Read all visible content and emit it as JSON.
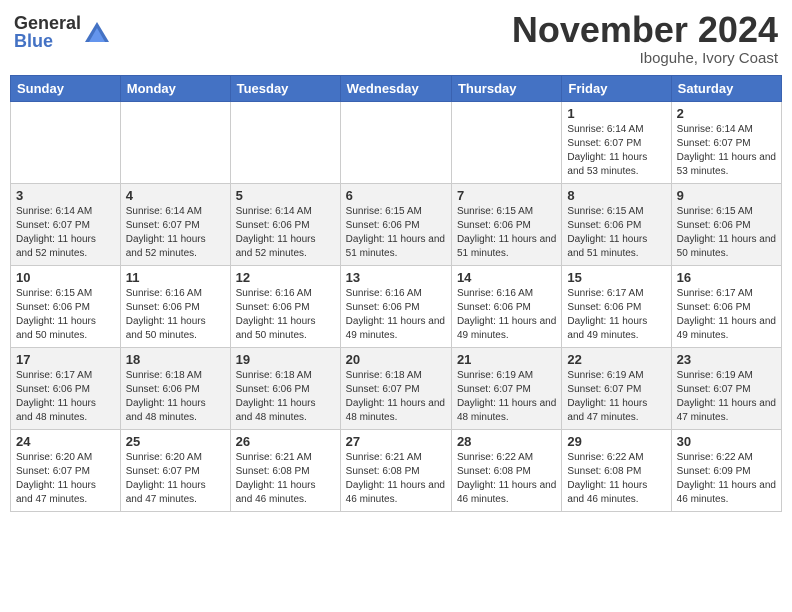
{
  "logo": {
    "general": "General",
    "blue": "Blue"
  },
  "title": "November 2024",
  "location": "Iboguhe, Ivory Coast",
  "weekdays": [
    "Sunday",
    "Monday",
    "Tuesday",
    "Wednesday",
    "Thursday",
    "Friday",
    "Saturday"
  ],
  "weeks": [
    [
      {
        "day": "",
        "info": ""
      },
      {
        "day": "",
        "info": ""
      },
      {
        "day": "",
        "info": ""
      },
      {
        "day": "",
        "info": ""
      },
      {
        "day": "",
        "info": ""
      },
      {
        "day": "1",
        "info": "Sunrise: 6:14 AM\nSunset: 6:07 PM\nDaylight: 11 hours and 53 minutes."
      },
      {
        "day": "2",
        "info": "Sunrise: 6:14 AM\nSunset: 6:07 PM\nDaylight: 11 hours and 53 minutes."
      }
    ],
    [
      {
        "day": "3",
        "info": "Sunrise: 6:14 AM\nSunset: 6:07 PM\nDaylight: 11 hours and 52 minutes."
      },
      {
        "day": "4",
        "info": "Sunrise: 6:14 AM\nSunset: 6:07 PM\nDaylight: 11 hours and 52 minutes."
      },
      {
        "day": "5",
        "info": "Sunrise: 6:14 AM\nSunset: 6:06 PM\nDaylight: 11 hours and 52 minutes."
      },
      {
        "day": "6",
        "info": "Sunrise: 6:15 AM\nSunset: 6:06 PM\nDaylight: 11 hours and 51 minutes."
      },
      {
        "day": "7",
        "info": "Sunrise: 6:15 AM\nSunset: 6:06 PM\nDaylight: 11 hours and 51 minutes."
      },
      {
        "day": "8",
        "info": "Sunrise: 6:15 AM\nSunset: 6:06 PM\nDaylight: 11 hours and 51 minutes."
      },
      {
        "day": "9",
        "info": "Sunrise: 6:15 AM\nSunset: 6:06 PM\nDaylight: 11 hours and 50 minutes."
      }
    ],
    [
      {
        "day": "10",
        "info": "Sunrise: 6:15 AM\nSunset: 6:06 PM\nDaylight: 11 hours and 50 minutes."
      },
      {
        "day": "11",
        "info": "Sunrise: 6:16 AM\nSunset: 6:06 PM\nDaylight: 11 hours and 50 minutes."
      },
      {
        "day": "12",
        "info": "Sunrise: 6:16 AM\nSunset: 6:06 PM\nDaylight: 11 hours and 50 minutes."
      },
      {
        "day": "13",
        "info": "Sunrise: 6:16 AM\nSunset: 6:06 PM\nDaylight: 11 hours and 49 minutes."
      },
      {
        "day": "14",
        "info": "Sunrise: 6:16 AM\nSunset: 6:06 PM\nDaylight: 11 hours and 49 minutes."
      },
      {
        "day": "15",
        "info": "Sunrise: 6:17 AM\nSunset: 6:06 PM\nDaylight: 11 hours and 49 minutes."
      },
      {
        "day": "16",
        "info": "Sunrise: 6:17 AM\nSunset: 6:06 PM\nDaylight: 11 hours and 49 minutes."
      }
    ],
    [
      {
        "day": "17",
        "info": "Sunrise: 6:17 AM\nSunset: 6:06 PM\nDaylight: 11 hours and 48 minutes."
      },
      {
        "day": "18",
        "info": "Sunrise: 6:18 AM\nSunset: 6:06 PM\nDaylight: 11 hours and 48 minutes."
      },
      {
        "day": "19",
        "info": "Sunrise: 6:18 AM\nSunset: 6:06 PM\nDaylight: 11 hours and 48 minutes."
      },
      {
        "day": "20",
        "info": "Sunrise: 6:18 AM\nSunset: 6:07 PM\nDaylight: 11 hours and 48 minutes."
      },
      {
        "day": "21",
        "info": "Sunrise: 6:19 AM\nSunset: 6:07 PM\nDaylight: 11 hours and 48 minutes."
      },
      {
        "day": "22",
        "info": "Sunrise: 6:19 AM\nSunset: 6:07 PM\nDaylight: 11 hours and 47 minutes."
      },
      {
        "day": "23",
        "info": "Sunrise: 6:19 AM\nSunset: 6:07 PM\nDaylight: 11 hours and 47 minutes."
      }
    ],
    [
      {
        "day": "24",
        "info": "Sunrise: 6:20 AM\nSunset: 6:07 PM\nDaylight: 11 hours and 47 minutes."
      },
      {
        "day": "25",
        "info": "Sunrise: 6:20 AM\nSunset: 6:07 PM\nDaylight: 11 hours and 47 minutes."
      },
      {
        "day": "26",
        "info": "Sunrise: 6:21 AM\nSunset: 6:08 PM\nDaylight: 11 hours and 46 minutes."
      },
      {
        "day": "27",
        "info": "Sunrise: 6:21 AM\nSunset: 6:08 PM\nDaylight: 11 hours and 46 minutes."
      },
      {
        "day": "28",
        "info": "Sunrise: 6:22 AM\nSunset: 6:08 PM\nDaylight: 11 hours and 46 minutes."
      },
      {
        "day": "29",
        "info": "Sunrise: 6:22 AM\nSunset: 6:08 PM\nDaylight: 11 hours and 46 minutes."
      },
      {
        "day": "30",
        "info": "Sunrise: 6:22 AM\nSunset: 6:09 PM\nDaylight: 11 hours and 46 minutes."
      }
    ]
  ]
}
